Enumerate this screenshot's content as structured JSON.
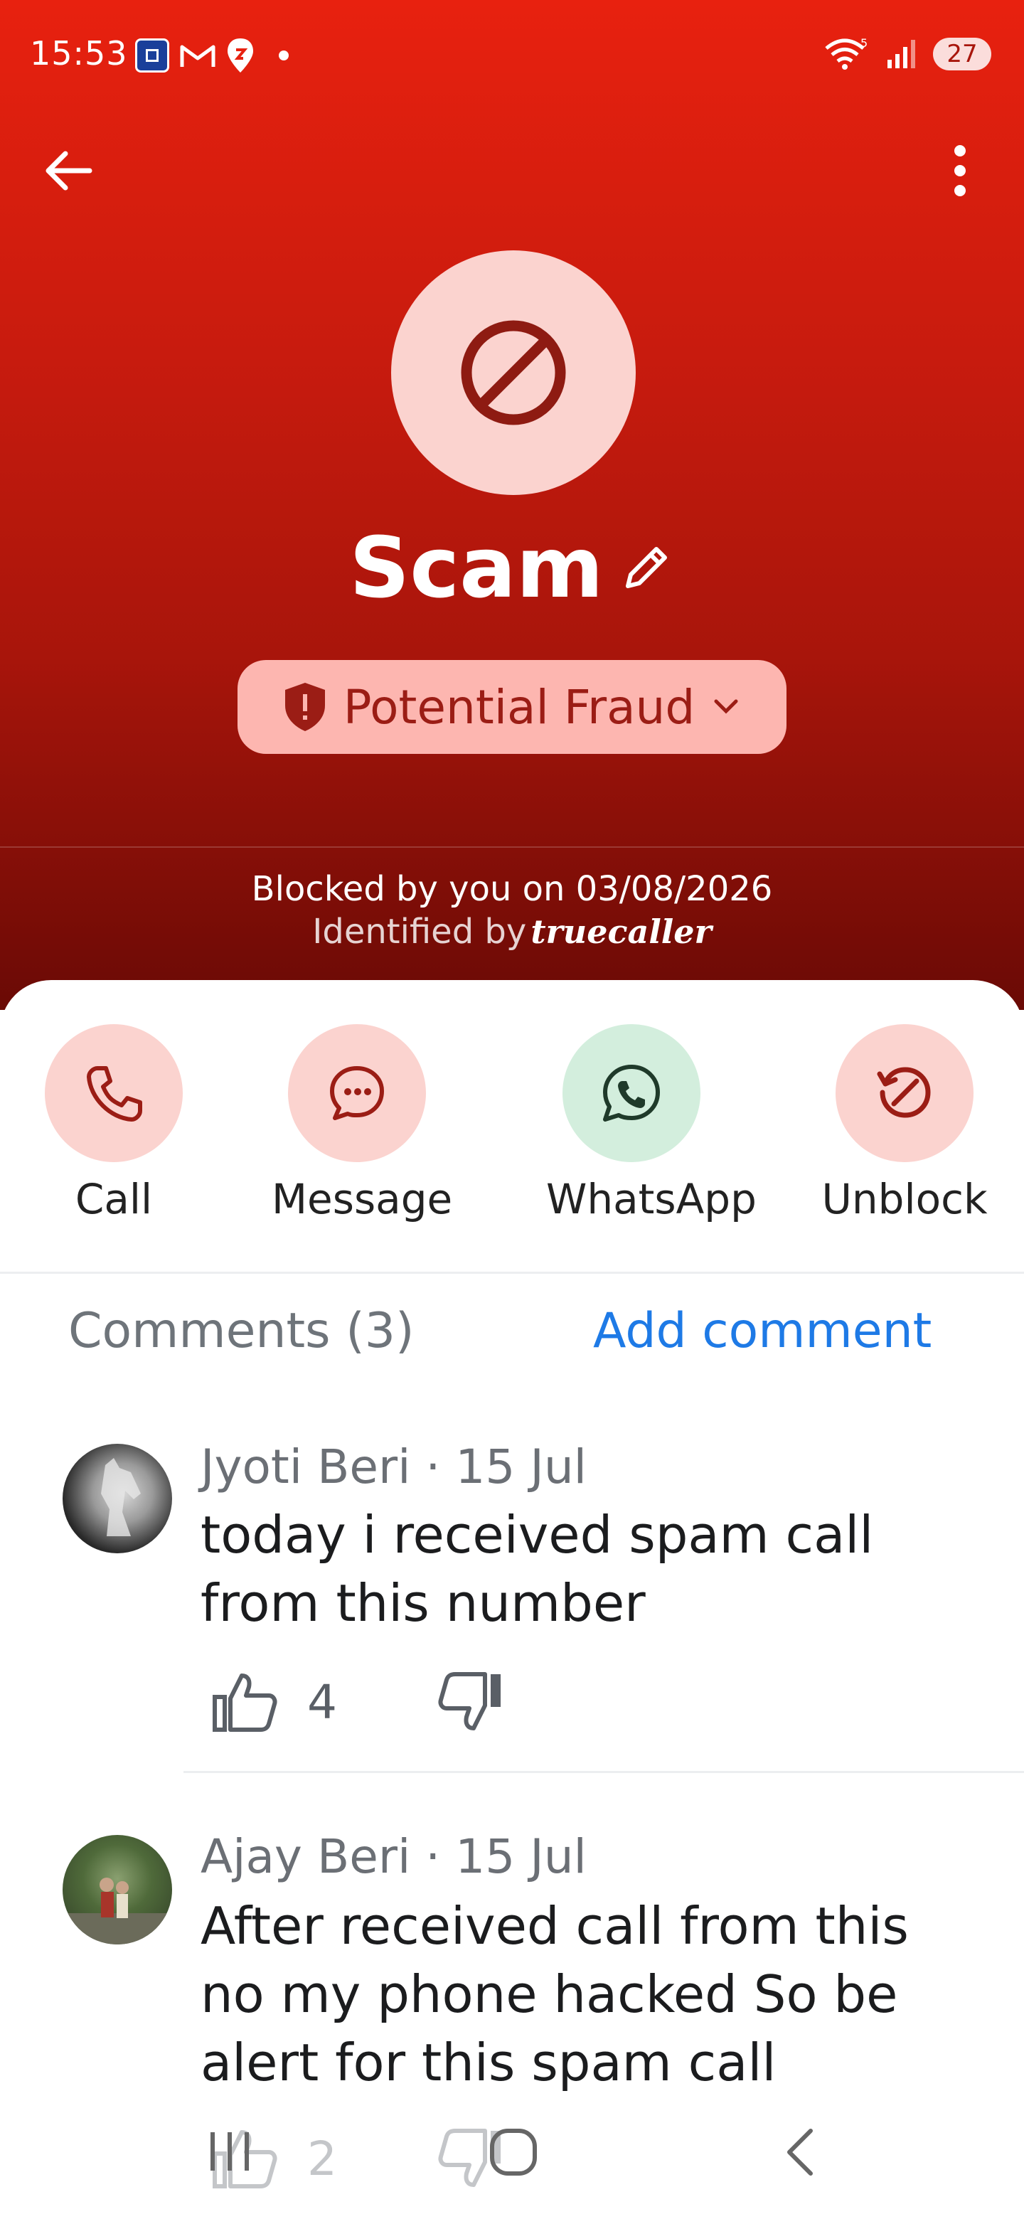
{
  "status_bar": {
    "time": "15:53",
    "battery": "27",
    "signal_label": "5"
  },
  "contact": {
    "name": "Scam",
    "tag": "Potential Fraud",
    "blocked_text": "Blocked by you on 03/08/2026",
    "identified_text": "Identified by",
    "brand": "truecaller"
  },
  "actions": [
    {
      "label": "Call",
      "icon": "phone-icon"
    },
    {
      "label": "Message",
      "icon": "message-icon"
    },
    {
      "label": "WhatsApp",
      "icon": "whatsapp-icon"
    },
    {
      "label": "Unblock",
      "icon": "unblock-icon"
    }
  ],
  "comments": {
    "header": "Comments (3)",
    "add_label": "Add comment",
    "items": [
      {
        "author_meta": "Jyoti Beri · 15 Jul",
        "text": "today i received spam call from this number",
        "likes": "4"
      },
      {
        "author_meta": "Ajay Beri · 15 Jul",
        "text": "After received call from this no my phone hacked So be alert for this spam call",
        "likes": "2"
      }
    ]
  },
  "colors": {
    "hero_top": "#e8210f",
    "hero_bottom": "#6a0a05",
    "badge_bg": "#fdb6b0",
    "link": "#1e7ae6",
    "whatsapp_bg": "#d3eedd"
  }
}
